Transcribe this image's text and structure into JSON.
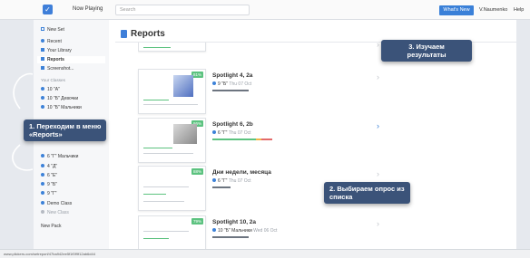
{
  "topbar": {
    "logo_glyph": "✓",
    "now_playing": "Now Playing",
    "search_placeholder": "Search",
    "whats_new": "What's New",
    "user": "V.Naumenko",
    "help": "Help"
  },
  "sidebar": {
    "new_set": "New Set",
    "recent": "Recent",
    "library": "Your Library",
    "reports": "Reports",
    "screenshots": "Screenshot...",
    "your_classes": "Your Classes",
    "classes": [
      "10 \"A\"",
      "10 \"Б\" Девочки",
      "10 \"Б\" Мальчики",
      "6 \"Г\" Мальчики",
      "4 \"Д\"",
      "6 \"Е\"",
      "9 \"Б\"",
      "9 \"Г\"",
      "Demo Class"
    ],
    "new_class": "New Class",
    "new_pack": "New Pack"
  },
  "page": {
    "title": "Reports"
  },
  "reports": [
    {
      "title": "Spotlight 4, 2a",
      "cls": "9 \"Б\"",
      "date": "Thu 07 Oct",
      "pct": "81%"
    },
    {
      "title": "Spotlight 6, 2b",
      "cls": "6 \"Г\"",
      "date": "Thu 07 Oct",
      "pct": "86%"
    },
    {
      "title": "Дни недели, месяца",
      "cls": "6 \"Г\"",
      "date": "Thu 07 Oct",
      "pct": "88%"
    },
    {
      "title": "Spotlight 10, 2a",
      "cls": "10 \"Б\" Мальчики",
      "date": "Wed 06 Oct",
      "pct": "79%"
    }
  ],
  "status_url": "www.plickers.com/setreport/47ba942ee5f1f0f9f12ab6d44",
  "callouts": {
    "step1_line1": "1. Переходим в меню",
    "step1_line2": "«Reports»",
    "step2_line1": "2. Выбираем опрос из",
    "step2_line2": "списка",
    "step3_line1": "3. Изучаем",
    "step3_line2": "результаты"
  },
  "colors": {
    "accent": "#3a80d8",
    "success": "#5cc27f",
    "callout": "#3b5379"
  }
}
